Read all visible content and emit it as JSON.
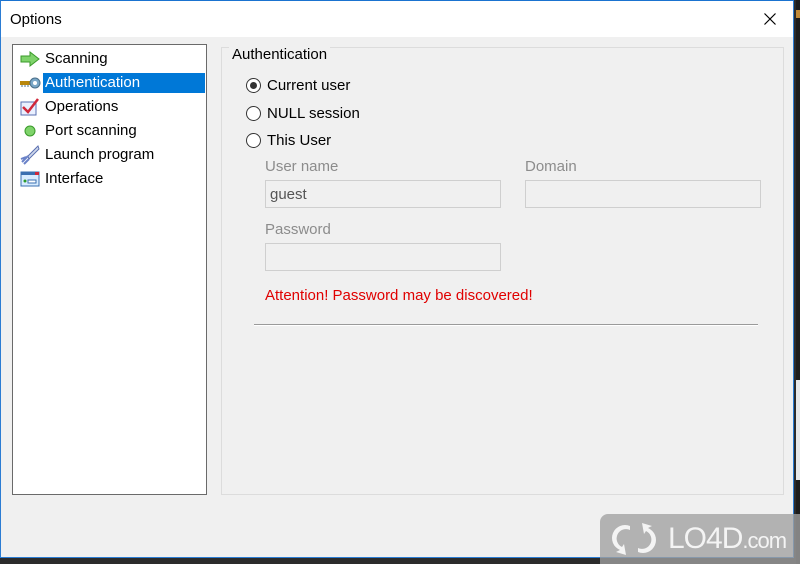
{
  "window": {
    "title": "Options",
    "close_icon": "close-icon"
  },
  "nav": {
    "items": [
      {
        "label": "Scanning",
        "icon": "green-arrow-icon",
        "selected": false
      },
      {
        "label": "Authentication",
        "icon": "key-icon",
        "selected": true
      },
      {
        "label": "Operations",
        "icon": "checkmark-box-icon",
        "selected": false
      },
      {
        "label": "Port scanning",
        "icon": "green-dot-icon",
        "selected": false
      },
      {
        "label": "Launch program",
        "icon": "rocket-icon",
        "selected": false
      },
      {
        "label": "Interface",
        "icon": "window-icon",
        "selected": false
      }
    ]
  },
  "auth": {
    "group_title": "Authentication",
    "options": [
      {
        "label": "Current user",
        "checked": true
      },
      {
        "label": "NULL session",
        "checked": false
      },
      {
        "label": "This User",
        "checked": false
      }
    ],
    "username_label": "User name",
    "username_value": "guest",
    "domain_label": "Domain",
    "domain_value": "",
    "password_label": "Password",
    "password_value": "",
    "warning": "Attention! Password may be discovered!",
    "warning_color": "#e00000"
  },
  "watermark": {
    "brand": "LO4D",
    "suffix": ".com"
  }
}
